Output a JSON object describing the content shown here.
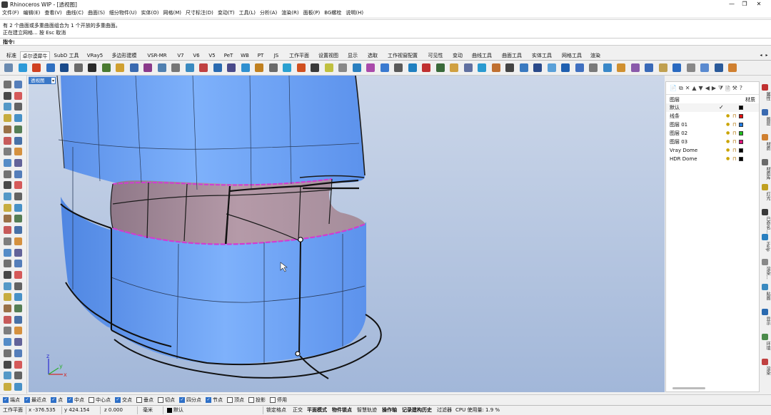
{
  "window": {
    "title": "Rhinoceros WIP - [透视图]",
    "controls": [
      "—",
      "❐",
      "✕"
    ]
  },
  "menu": [
    "文件(F)",
    "编辑(E)",
    "查看(V)",
    "曲线(C)",
    "曲面(S)",
    "细分物件(U)",
    "实体(O)",
    "网格(M)",
    "尺寸标注(D)",
    "变动(T)",
    "工具(L)",
    "分析(A)",
    "渲染(R)",
    "面板(P)",
    "BG螺栓",
    "说明(H)"
  ],
  "history": [
    "有 2 个曲面或多重曲面组合为 1 个开放的多重曲面。",
    "正在建立网格... 按 Esc 取消"
  ],
  "command": {
    "prompt": "指令:"
  },
  "tabs": [
    "标准",
    "卓尔谟犀牛",
    "SubD 工具",
    "VRay5",
    "多边形建模",
    "VSR-MR",
    "V7",
    "V6",
    "V5",
    "PeT",
    "WB",
    "PT",
    "JS",
    "工作平面",
    "设置视图",
    "显示",
    "选取",
    "工作视窗配置",
    "可见性",
    "变动",
    "曲线工具",
    "曲面工具",
    "实体工具",
    "网格工具",
    "渲染"
  ],
  "tab_active_index": 1,
  "tab_scroll": [
    "◂",
    "▸"
  ],
  "viewport": {
    "label": "透视图",
    "menu_arrow": "▾",
    "axis_x": "x",
    "axis_y": "y",
    "axis_z": "z"
  },
  "layers": {
    "header_name": "图层",
    "header_material": "材质",
    "toolbar_icons": [
      "📄",
      "⧉",
      "✕",
      "▲",
      "▼",
      "◀",
      "▶",
      "⧩",
      "🗎",
      "⚒",
      "?"
    ],
    "rows": [
      {
        "name": "默认",
        "current": "✓",
        "color": "#000000"
      },
      {
        "name": "线条",
        "current": "",
        "color": "#e01010"
      },
      {
        "name": "图层 01",
        "current": "",
        "color": "#1f7ae0"
      },
      {
        "name": "图层 02",
        "current": "",
        "color": "#20c020"
      },
      {
        "name": "图层 03",
        "current": "",
        "color": "#e0107a"
      },
      {
        "name": "Vray Dome",
        "current": "",
        "color": "#000000"
      },
      {
        "name": "HDR Dome",
        "current": "",
        "color": "#000000"
      }
    ]
  },
  "right_dock": [
    "属性",
    "图层",
    "材质",
    "材质库",
    "灯光",
    "已命名...",
    "Help",
    "渲染...",
    "贴图",
    "显示",
    "环境",
    "渲染"
  ],
  "snaps": [
    {
      "label": "端点",
      "on": true
    },
    {
      "label": "最近点",
      "on": true
    },
    {
      "label": "点",
      "on": true
    },
    {
      "label": "中点",
      "on": true
    },
    {
      "label": "中心点",
      "on": false
    },
    {
      "label": "交点",
      "on": true
    },
    {
      "label": "垂点",
      "on": false
    },
    {
      "label": "切点",
      "on": false
    },
    {
      "label": "四分点",
      "on": true
    },
    {
      "label": "节点",
      "on": true
    },
    {
      "label": "顶点",
      "on": false
    },
    {
      "label": "投影",
      "on": false
    },
    {
      "label": "停用",
      "on": false
    }
  ],
  "status": {
    "cplane": "工作平面",
    "x": "x -376.535",
    "y": "y 424.154",
    "z": "z 0.000",
    "units": "毫米",
    "layer": "默认",
    "lock_grid": "锁定格点",
    "ortho": "正交",
    "planar": "平面模式",
    "osnap": "物件锁点",
    "smarttrack": "智慧轨迹",
    "gumball": "操作轴",
    "history": "记录建构历史",
    "filter": "过滤器",
    "cpu": "CPU 使用量: 1.9 %"
  },
  "colors": {
    "viewport_top": "#ccd7e9",
    "viewport_bottom": "#a2b7d9",
    "surface_blue": "#6aa0f4",
    "surface_inner": "#a28a99",
    "edge_magenta": "#d23cd2",
    "accent": "#2d6fc7"
  }
}
